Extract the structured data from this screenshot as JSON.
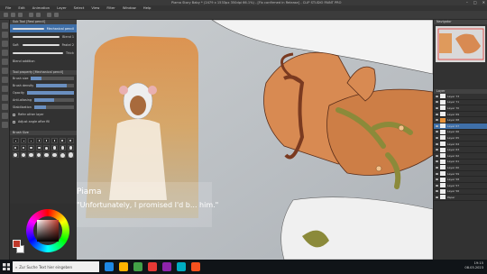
{
  "window": {
    "title": "Piama Story Baby * (2479 x 1533px 350dpi 66.1%) - [Fix confirmed in Release] - CLIP STUDIO PAINT PRO",
    "controls": [
      "–",
      "□",
      "✕"
    ]
  },
  "menu": [
    "File",
    "Edit",
    "Animation",
    "Layer",
    "Select",
    "View",
    "Filter",
    "Window",
    "Help"
  ],
  "sub_tool": {
    "header": "Sub Tool [Real pencil]",
    "brushes": [
      {
        "label": "Mechanical pencil",
        "selected": true
      },
      {
        "label": "Blend 1"
      },
      {
        "label": "Soft",
        "note": "Pastel 2"
      },
      {
        "label": "Thick"
      },
      {
        "label": "Blend addition"
      }
    ]
  },
  "tool_property": {
    "header": "Tool property [Mechanical pencil]",
    "rows": [
      {
        "label": "Brush size",
        "fill": 0.25
      },
      {
        "label": "Brush density",
        "fill": 0.8
      },
      {
        "label": "Opacity",
        "fill": 1.0
      },
      {
        "label": "Anti-aliasing",
        "fill": 0.5
      },
      {
        "label": "Stabilization",
        "fill": 0.3
      }
    ],
    "checks": [
      "Refer other layer",
      "Adjust angle after fill"
    ]
  },
  "brush_size_panel": {
    "header": "Brush Size"
  },
  "color": {
    "main": "#c0392b",
    "sub": "#ffffff"
  },
  "canvas": {
    "dialog_speaker": "Piama",
    "dialog_line": "\"Unfortunately, I promised I'd b... him.\""
  },
  "navigator": {
    "header": "Navigator"
  },
  "layers": {
    "header": "Layer",
    "items": [
      {
        "name": "Layer 73"
      },
      {
        "name": "Layer 71"
      },
      {
        "name": "Layer 70"
      },
      {
        "name": "Layer 69"
      },
      {
        "name": "Layer 68",
        "orange": true
      },
      {
        "name": "Layer 67",
        "selected": true
      },
      {
        "name": "Layer 66"
      },
      {
        "name": "Layer 65"
      },
      {
        "name": "Layer 64"
      },
      {
        "name": "Layer 63"
      },
      {
        "name": "Layer 62"
      },
      {
        "name": "Layer 61"
      },
      {
        "name": "Layer 60"
      },
      {
        "name": "Layer 59"
      },
      {
        "name": "Layer 58"
      },
      {
        "name": "Layer 57"
      },
      {
        "name": "Layer 56"
      },
      {
        "name": "Paper"
      }
    ]
  },
  "taskbar": {
    "search_placeholder": "Zur Suche Text hier eingeben",
    "time": "19:15",
    "date": "08.03.2023",
    "icon_colors": [
      "#1e88e5",
      "#ffb300",
      "#43a047",
      "#e53935",
      "#8e24aa",
      "#00acc1",
      "#f4511e"
    ]
  }
}
